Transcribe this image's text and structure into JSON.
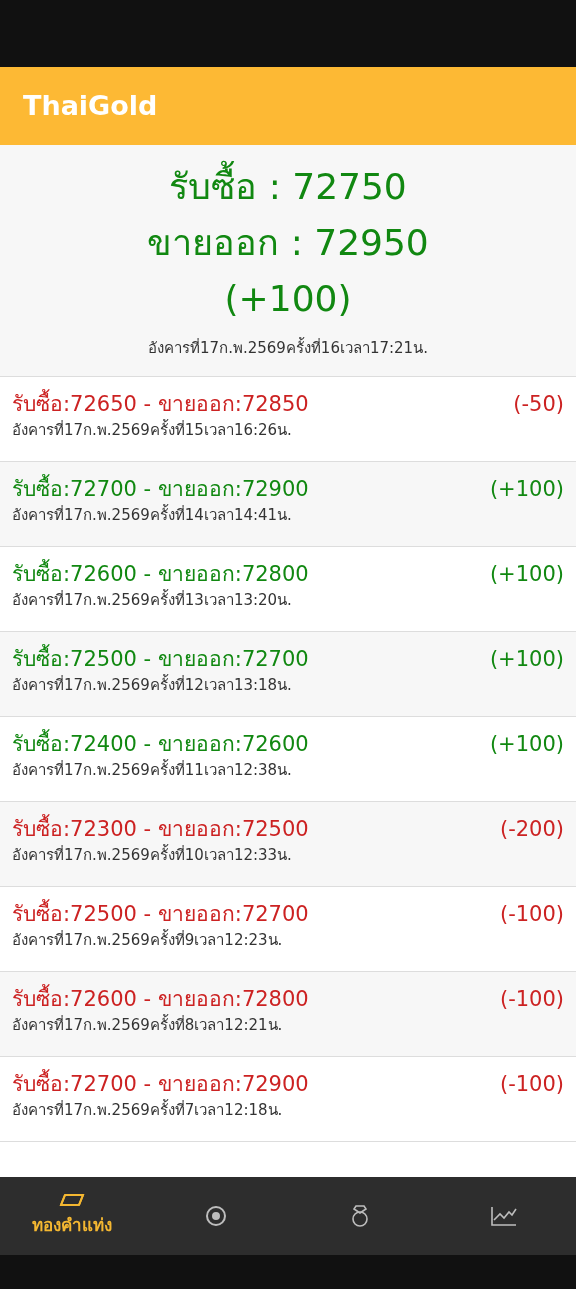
{
  "app_bar": {
    "title": "ThaiGold"
  },
  "summary": {
    "buy": "รับซื้อ : 72750",
    "sell": "ขายออก : 72950",
    "change": "(+100)",
    "kind": "up",
    "timestamp": "อังคารที่17ก.พ.2569ครั้งที่16เวลา17:21น."
  },
  "history": [
    {
      "prices": "รับซื้อ:72650 - ขายออก:72850",
      "change": "(-50)",
      "kind": "down",
      "timestamp": "อังคารที่17ก.พ.2569ครั้งที่15เวลา16:26น."
    },
    {
      "prices": "รับซื้อ:72700 - ขายออก:72900",
      "change": "(+100)",
      "kind": "up",
      "timestamp": "อังคารที่17ก.พ.2569ครั้งที่14เวลา14:41น."
    },
    {
      "prices": "รับซื้อ:72600 - ขายออก:72800",
      "change": "(+100)",
      "kind": "up",
      "timestamp": "อังคารที่17ก.พ.2569ครั้งที่13เวลา13:20น."
    },
    {
      "prices": "รับซื้อ:72500 - ขายออก:72700",
      "change": "(+100)",
      "kind": "up",
      "timestamp": "อังคารที่17ก.พ.2569ครั้งที่12เวลา13:18น."
    },
    {
      "prices": "รับซื้อ:72400 - ขายออก:72600",
      "change": "(+100)",
      "kind": "up",
      "timestamp": "อังคารที่17ก.พ.2569ครั้งที่11เวลา12:38น."
    },
    {
      "prices": "รับซื้อ:72300 - ขายออก:72500",
      "change": "(-200)",
      "kind": "down",
      "timestamp": "อังคารที่17ก.พ.2569ครั้งที่10เวลา12:33น."
    },
    {
      "prices": "รับซื้อ:72500 - ขายออก:72700",
      "change": "(-100)",
      "kind": "down",
      "timestamp": "อังคารที่17ก.พ.2569ครั้งที่9เวลา12:23น."
    },
    {
      "prices": "รับซื้อ:72600 - ขายออก:72800",
      "change": "(-100)",
      "kind": "down",
      "timestamp": "อังคารที่17ก.พ.2569ครั้งที่8เวลา12:21น."
    },
    {
      "prices": "รับซื้อ:72700 - ขายออก:72900",
      "change": "(-100)",
      "kind": "down",
      "timestamp": "อังคารที่17ก.พ.2569ครั้งที่7เวลา12:18น."
    }
  ],
  "bottom_nav": [
    {
      "kind": "ingot",
      "label": "ทองคำแท่ง",
      "selected": true
    },
    {
      "kind": "target",
      "selected": false
    },
    {
      "kind": "ring",
      "selected": false
    },
    {
      "kind": "chart",
      "selected": false
    }
  ]
}
